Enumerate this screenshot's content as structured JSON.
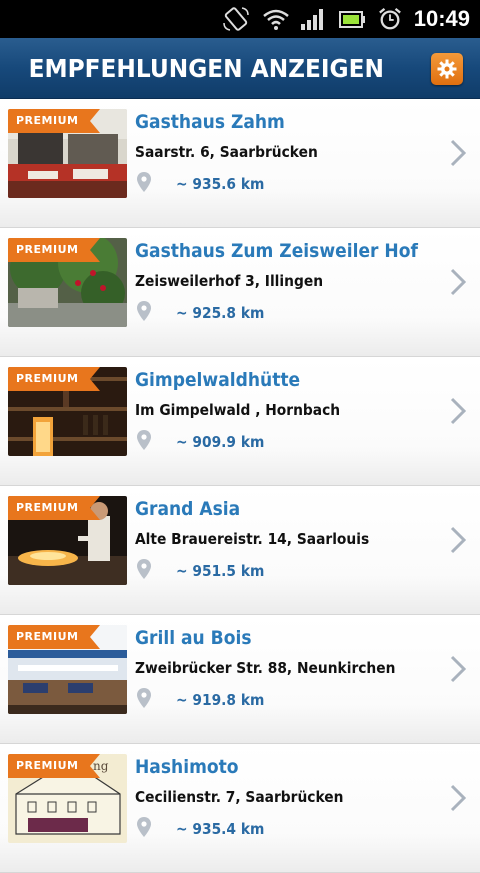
{
  "status_bar": {
    "time": "10:49"
  },
  "header": {
    "title": "EMPFEHLUNGEN ANZEIGEN"
  },
  "items": [
    {
      "badge": "PREMIUM",
      "name": "Gasthaus Zahm",
      "address": "Saarstr. 6, Saarbrücken",
      "distance": "~ 935.6 km"
    },
    {
      "badge": "PREMIUM",
      "name": "Gasthaus Zum Zeisweiler Hof",
      "address": "Zeisweilerhof 3, Illingen",
      "distance": "~ 925.8 km"
    },
    {
      "badge": "PREMIUM",
      "name": "Gimpelwaldhütte",
      "address": "Im Gimpelwald , Hornbach",
      "distance": "~ 909.9 km"
    },
    {
      "badge": "PREMIUM",
      "name": "Grand Asia",
      "address": "Alte Brauereistr. 14, Saarlouis",
      "distance": "~ 951.5 km"
    },
    {
      "badge": "PREMIUM",
      "name": "Grill au Bois",
      "address": "Zweibrücker Str. 88, Neunkirchen",
      "distance": "~ 919.8 km"
    },
    {
      "badge": "PREMIUM",
      "name": "Hashimoto",
      "address": "Cecilienstr. 7, Saarbrücken",
      "distance": "~ 935.4 km"
    }
  ]
}
